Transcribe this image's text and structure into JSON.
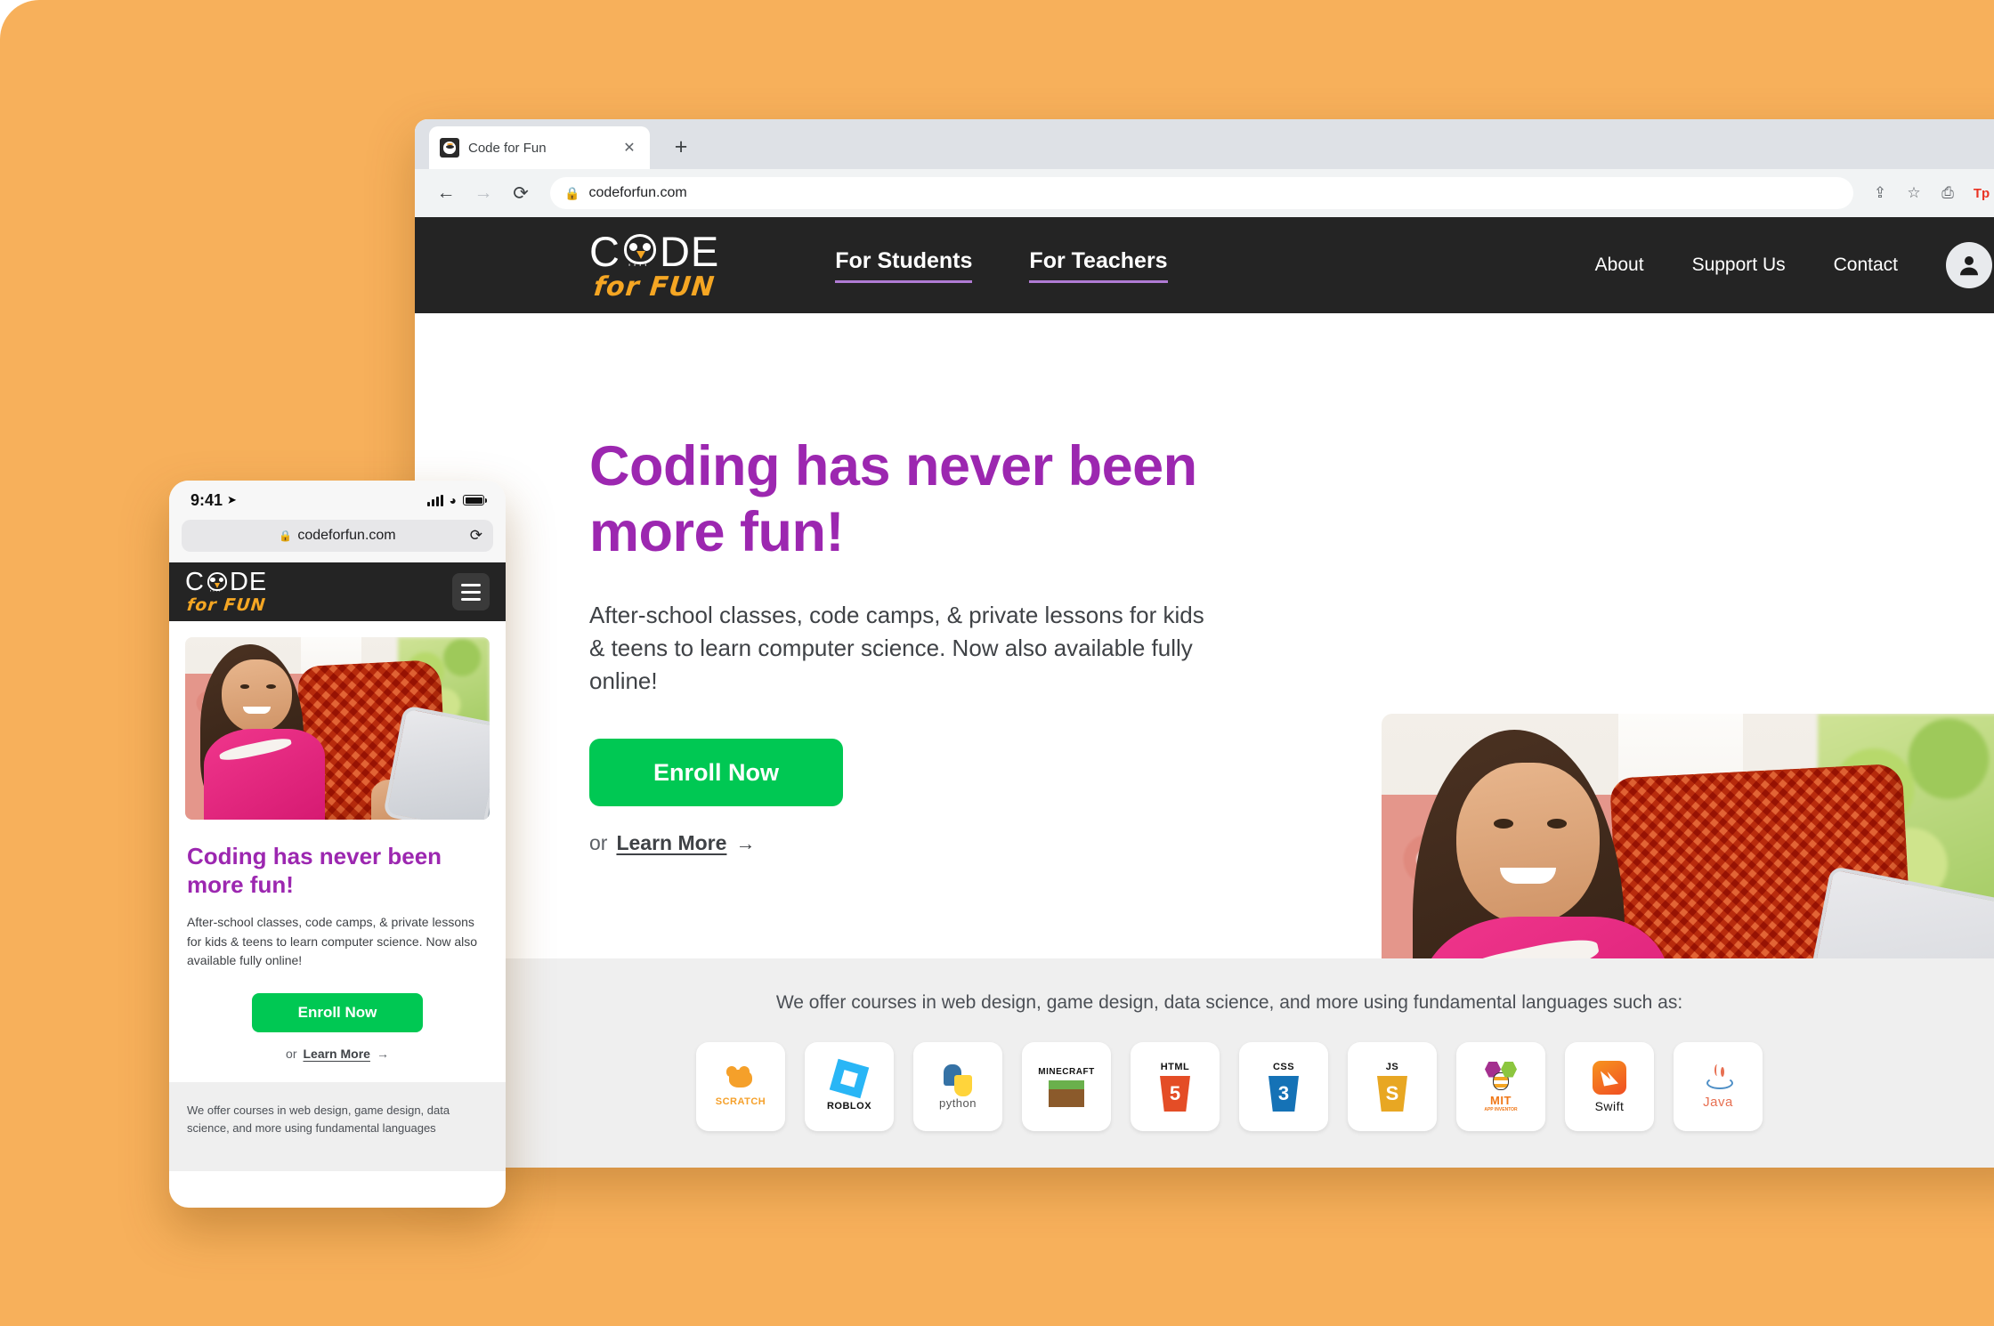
{
  "browser": {
    "tab": {
      "title": "Code for Fun",
      "favicon": "owl-favicon",
      "close_label": "✕"
    },
    "new_tab_label": "+",
    "back_label": "←",
    "forward_label": "→",
    "reload_label": "⟳",
    "omnibox": {
      "url": "codeforfun.com",
      "lock": "🔒"
    },
    "actions": [
      {
        "name": "share-icon",
        "glyph": "⇪"
      },
      {
        "name": "bookmark-star-icon",
        "glyph": "☆"
      },
      {
        "name": "screenshot-camera-icon",
        "glyph": "⎙"
      },
      {
        "name": "toolbar-extension-tp-icon",
        "glyph": "Tp"
      },
      {
        "name": "extensions-puzzle-icon",
        "glyph": "🧩"
      }
    ]
  },
  "site": {
    "logo": {
      "word": "CODE",
      "tagline": "for FUN"
    },
    "primary_nav": [
      {
        "label": "For Students"
      },
      {
        "label": "For Teachers"
      }
    ],
    "secondary_nav": [
      {
        "label": "About"
      },
      {
        "label": "Support Us"
      },
      {
        "label": "Contact"
      }
    ],
    "account_icon": "account-avatar-icon"
  },
  "hero": {
    "heading": "Coding has never been more fun!",
    "subtext": "After-school classes, code camps, & private lessons for kids & teens to learn computer science. Now also available fully online!",
    "cta_label": "Enroll Now",
    "or_label": "or",
    "learn_more_label": "Learn More",
    "learn_more_arrow": "→",
    "image_alt": "girl-with-tablet-photo"
  },
  "courses": {
    "caption": "We offer courses in web design, game design, data science, and more using fundamental languages such as:",
    "logos": [
      {
        "name": "scratch",
        "label": "SCRATCH"
      },
      {
        "name": "roblox",
        "label": "ROBLOX"
      },
      {
        "name": "python",
        "label": "python"
      },
      {
        "name": "minecraft",
        "label": "MINECRAFT"
      },
      {
        "name": "html5",
        "label": "HTML",
        "digit": "5"
      },
      {
        "name": "css3",
        "label": "CSS",
        "digit": "3"
      },
      {
        "name": "javascript",
        "label": "JS",
        "digit": "S"
      },
      {
        "name": "mit-app-inventor",
        "label": "MIT",
        "sublabel": "APP INVENTOR"
      },
      {
        "name": "swift",
        "label": "Swift"
      },
      {
        "name": "java",
        "label": "Java"
      }
    ]
  },
  "phone": {
    "status": {
      "time": "9:41",
      "location_icon": "➤",
      "signal": "signal-bars-icon",
      "wifi": "📶",
      "battery": "battery-icon"
    },
    "omnibox": {
      "url": "codeforfun.com",
      "lock": "🔒",
      "reload": "⟳"
    },
    "logo": {
      "word": "CODE",
      "tagline": "for FUN"
    },
    "menu_label": "hamburger-menu",
    "heading": "Coding has never been more fun!",
    "subtext": "After-school classes, code camps, & private lessons for kids & teens to learn computer science. Now also available fully online!",
    "cta_label": "Enroll Now",
    "or_label": "or",
    "learn_more_label": "Learn More",
    "learn_more_arrow": "→",
    "courses_caption": "We offer courses in web design, game design, data science, and more using fundamental languages"
  },
  "colors": {
    "backdrop_orange": "#f7b05b",
    "header_dark": "#242424",
    "accent_purple": "#9c27b0",
    "nav_underline": "#b07bd4",
    "cta_green": "#00c853",
    "logo_orange": "#f5a623",
    "courses_bg": "#efefef"
  }
}
